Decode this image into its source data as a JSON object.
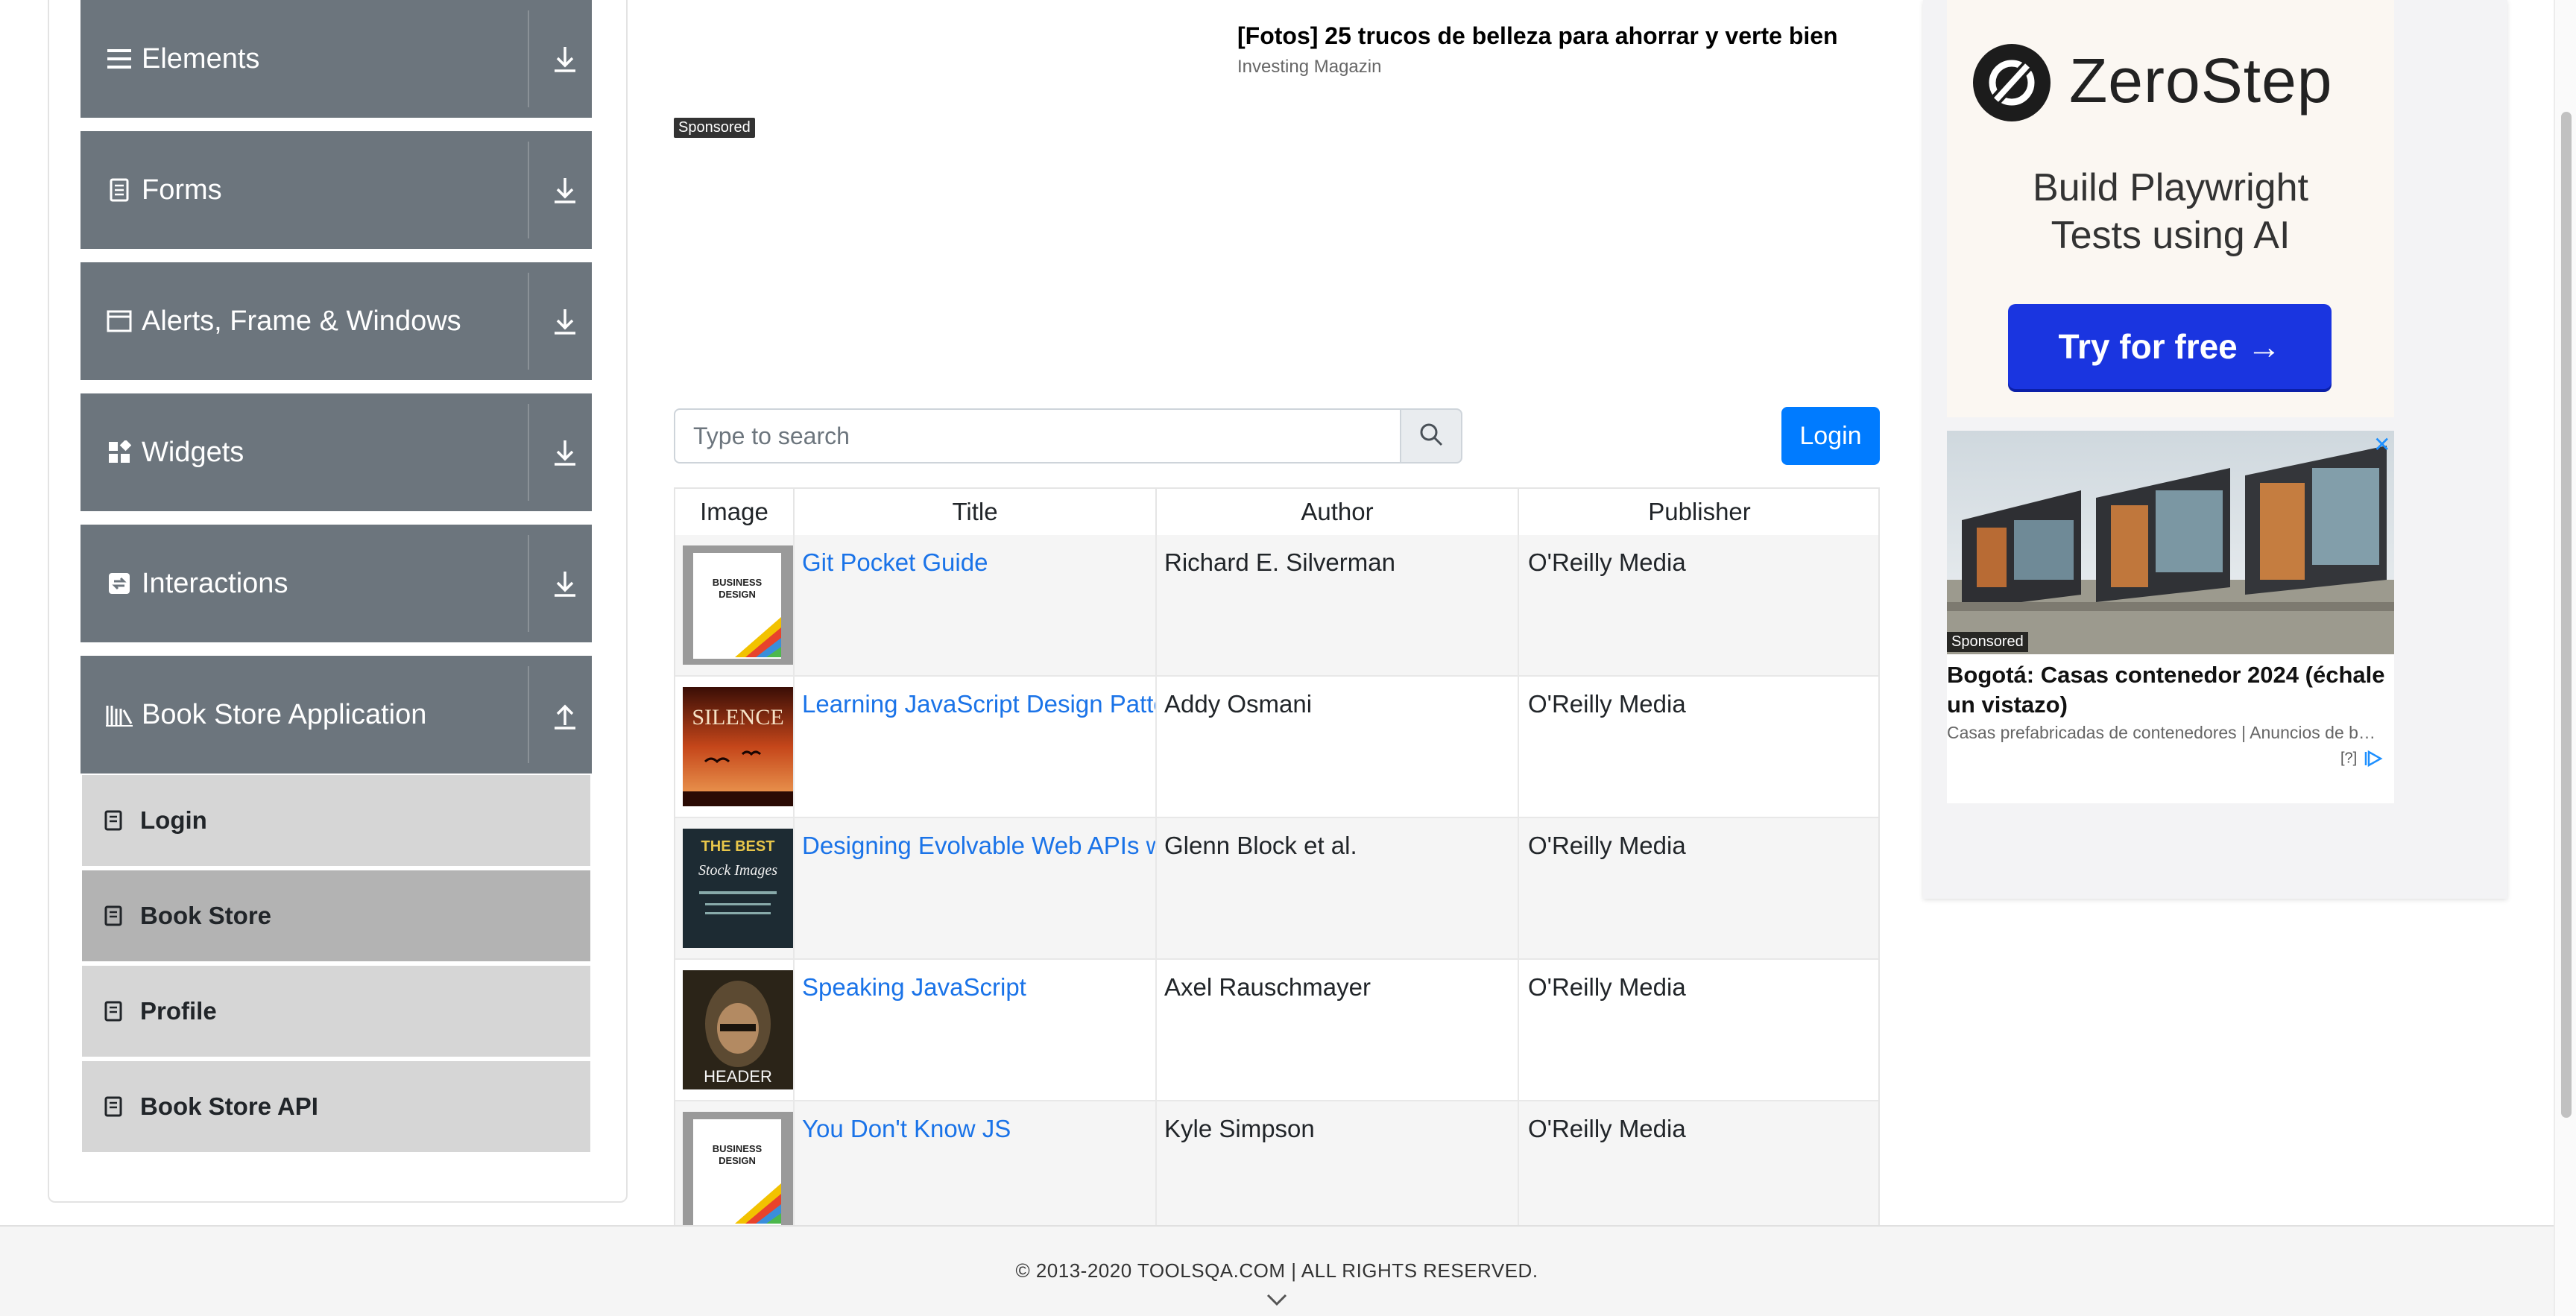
{
  "sidebar": {
    "groups": [
      {
        "label": "Elements",
        "icon": "hamburger-icon",
        "arrow": "expand-down-icon"
      },
      {
        "label": "Forms",
        "icon": "document-icon",
        "arrow": "expand-down-icon"
      },
      {
        "label": "Alerts, Frame & Windows",
        "icon": "window-icon",
        "arrow": "expand-down-icon"
      },
      {
        "label": "Widgets",
        "icon": "widgets-icon",
        "arrow": "expand-down-icon"
      },
      {
        "label": "Interactions",
        "icon": "interactions-icon",
        "arrow": "expand-down-icon"
      },
      {
        "label": "Book Store Application",
        "icon": "bookstore-icon",
        "arrow": "collapse-up-icon"
      }
    ],
    "subitems": [
      {
        "label": "Login",
        "active": false
      },
      {
        "label": "Book Store",
        "active": true
      },
      {
        "label": "Profile",
        "active": false
      },
      {
        "label": "Book Store API",
        "active": false
      }
    ]
  },
  "ad": {
    "headline": "[Fotos] 25 trucos de belleza para ahorrar y verte bien",
    "source": "Investing Magazin",
    "sponsored": "Sponsored"
  },
  "search": {
    "placeholder": "Type to search",
    "value": ""
  },
  "login_label": "Login",
  "table": {
    "headers": [
      "Image",
      "Title",
      "Author",
      "Publisher"
    ],
    "rows": [
      {
        "title": "Git Pocket Guide",
        "author": "Richard E. Silverman",
        "publisher": "O'Reilly Media",
        "cover": "business-design-cover"
      },
      {
        "title": "Learning JavaScript Design Patterns",
        "author": "Addy Osmani",
        "publisher": "O'Reilly Media",
        "cover": "silence-cover"
      },
      {
        "title": "Designing Evolvable Web APIs with ASP.NET",
        "author": "Glenn Block et al.",
        "publisher": "O'Reilly Media",
        "cover": "best-stock-images-cover"
      },
      {
        "title": "Speaking JavaScript",
        "author": "Axel Rauschmayer",
        "publisher": "O'Reilly Media",
        "cover": "header-cover"
      },
      {
        "title": "You Don't Know JS",
        "author": "Kyle Simpson",
        "publisher": "O'Reilly Media",
        "cover": "business-design-cover"
      }
    ]
  },
  "covers": {
    "business": {
      "line1": "BUSINESS",
      "line2": "DESIGN"
    },
    "silence": "SILENCE",
    "stock": {
      "line1": "THE BEST",
      "line2": "Stock Images"
    },
    "header": "HEADER"
  },
  "right_ad": {
    "brand": "ZeroStep",
    "tagline_1": "Build Playwright",
    "tagline_2": "Tests using AI",
    "cta": "Try for free →",
    "colors": {
      "cta": "#1a35e0"
    }
  },
  "house_ad": {
    "sponsored": "Sponsored",
    "title": "Bogotá: Casas contenedor 2024 (échale un vistazo)",
    "source": "Casas prefabricadas de contenedores | Anuncios de b…",
    "choices": "[?]"
  },
  "footer": {
    "text": "© 2013-2020 TOOLSQA.COM | ALL RIGHTS RESERVED."
  },
  "colors": {
    "sidebar_header": "#6c757d",
    "sub_item": "#d6d6d6",
    "sub_item_active": "#b3b3b3",
    "link": "#1a73e8",
    "primary": "#007bff"
  }
}
